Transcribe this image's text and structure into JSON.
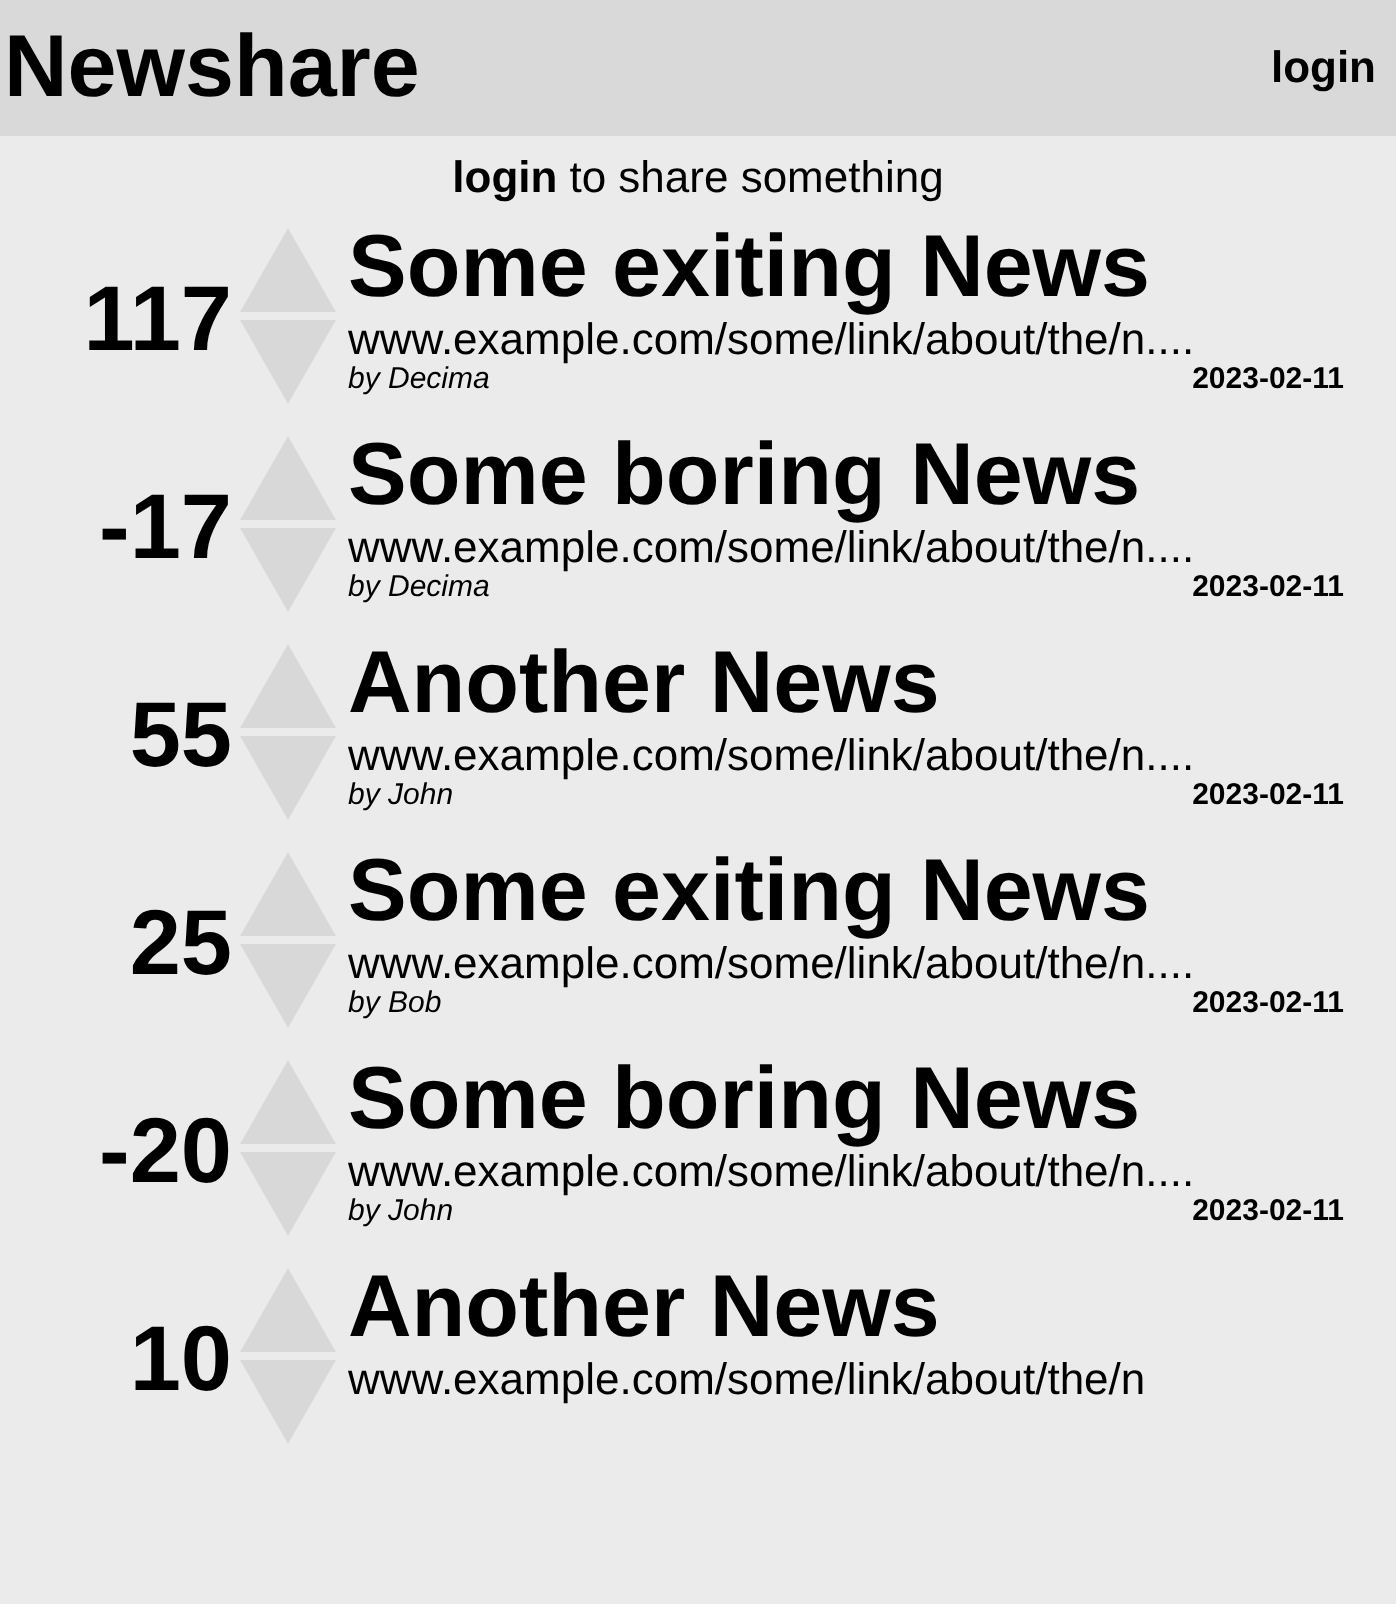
{
  "header": {
    "title": "Newshare",
    "login": "login"
  },
  "prompt": {
    "link": "login",
    "text": "to share something"
  },
  "posts": [
    {
      "score": "117",
      "title": "Some exiting News",
      "link": "www.example.com/some/link/about/the/n....",
      "author": "by Decima",
      "date": "2023-02-11"
    },
    {
      "score": "-17",
      "title": "Some boring News",
      "link": "www.example.com/some/link/about/the/n....",
      "author": "by Decima",
      "date": "2023-02-11"
    },
    {
      "score": "55",
      "title": "Another News",
      "link": "www.example.com/some/link/about/the/n....",
      "author": "by John",
      "date": "2023-02-11"
    },
    {
      "score": "25",
      "title": "Some exiting News",
      "link": "www.example.com/some/link/about/the/n....",
      "author": "by Bob",
      "date": "2023-02-11"
    },
    {
      "score": "-20",
      "title": "Some boring News",
      "link": "www.example.com/some/link/about/the/n....",
      "author": "by John",
      "date": "2023-02-11"
    },
    {
      "score": "10",
      "title": "Another News",
      "link": "www.example.com/some/link/about/the/n"
    }
  ]
}
